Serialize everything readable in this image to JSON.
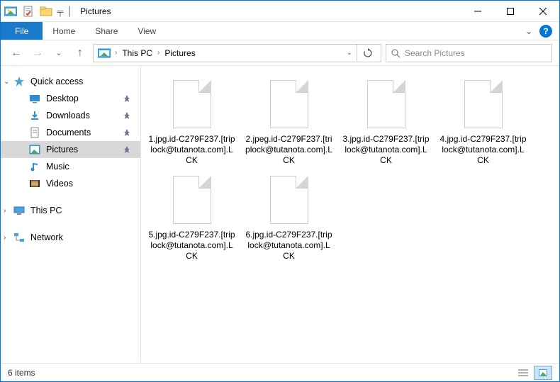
{
  "titlebar": {
    "title": "Pictures"
  },
  "ribbon": {
    "file": "File",
    "tabs": [
      "Home",
      "Share",
      "View"
    ]
  },
  "address": {
    "segments": [
      "This PC",
      "Pictures"
    ]
  },
  "search": {
    "placeholder": "Search Pictures"
  },
  "sidebar": {
    "quick_access": "Quick access",
    "items": [
      {
        "label": "Desktop",
        "icon": "desktop",
        "pinned": true
      },
      {
        "label": "Downloads",
        "icon": "downloads",
        "pinned": true
      },
      {
        "label": "Documents",
        "icon": "documents",
        "pinned": true
      },
      {
        "label": "Pictures",
        "icon": "pictures",
        "pinned": true,
        "selected": true
      },
      {
        "label": "Music",
        "icon": "music",
        "pinned": false
      },
      {
        "label": "Videos",
        "icon": "videos",
        "pinned": false
      }
    ],
    "this_pc": "This PC",
    "network": "Network"
  },
  "files": [
    {
      "name": "1.jpg.id-C279F237.[triplock@tutanota.com].LCK"
    },
    {
      "name": "2.jpeg.id-C279F237.[triplock@tutanota.com].LCK"
    },
    {
      "name": "3.jpg.id-C279F237.[triplock@tutanota.com].LCK"
    },
    {
      "name": "4.jpg.id-C279F237.[triplock@tutanota.com].LCK"
    },
    {
      "name": "5.jpg.id-C279F237.[triplock@tutanota.com].LCK"
    },
    {
      "name": "6.jpg.id-C279F237.[triplock@tutanota.com].LCK"
    }
  ],
  "statusbar": {
    "count_label": "6 items"
  }
}
